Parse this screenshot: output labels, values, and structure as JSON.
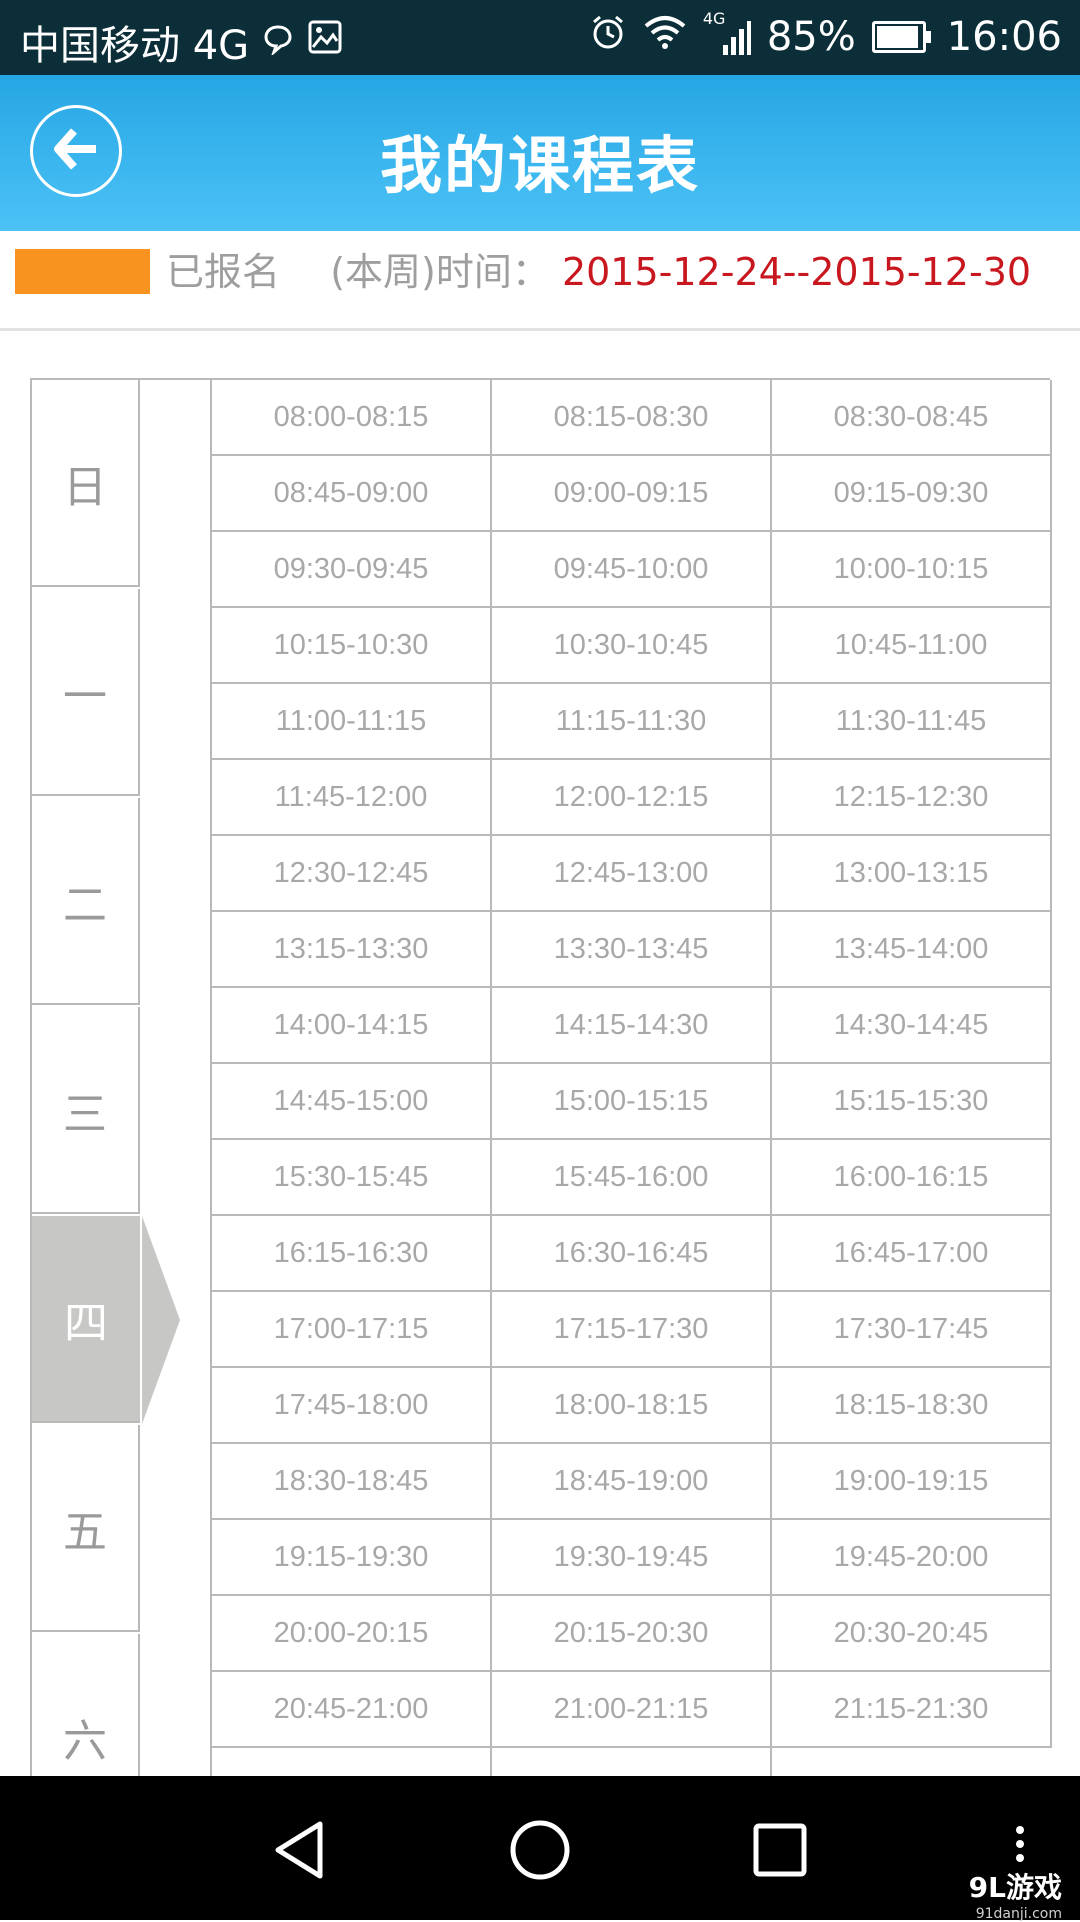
{
  "status_bar": {
    "carrier": "中国移动 4G",
    "signal_label": "4G",
    "battery": "85%",
    "battery_level": 0.85,
    "time": "16:06"
  },
  "header": {
    "title": "我的课程表"
  },
  "legend": {
    "swatch_color": "#f7931e",
    "registered_label": "已报名",
    "week_label": "(本周)时间：",
    "date_range": "2015-12-24--2015-12-30"
  },
  "days": [
    "日",
    "一",
    "二",
    "三",
    "四",
    "五",
    "六"
  ],
  "selected_day": "四",
  "time_slots": [
    "08:00-08:15",
    "08:15-08:30",
    "08:30-08:45",
    "08:45-09:00",
    "09:00-09:15",
    "09:15-09:30",
    "09:30-09:45",
    "09:45-10:00",
    "10:00-10:15",
    "10:15-10:30",
    "10:30-10:45",
    "10:45-11:00",
    "11:00-11:15",
    "11:15-11:30",
    "11:30-11:45",
    "11:45-12:00",
    "12:00-12:15",
    "12:15-12:30",
    "12:30-12:45",
    "12:45-13:00",
    "13:00-13:15",
    "13:15-13:30",
    "13:30-13:45",
    "13:45-14:00",
    "14:00-14:15",
    "14:15-14:30",
    "14:30-14:45",
    "14:45-15:00",
    "15:00-15:15",
    "15:15-15:30",
    "15:30-15:45",
    "15:45-16:00",
    "16:00-16:15",
    "16:15-16:30",
    "16:30-16:45",
    "16:45-17:00",
    "17:00-17:15",
    "17:15-17:30",
    "17:30-17:45",
    "17:45-18:00",
    "18:00-18:15",
    "18:15-18:30",
    "18:30-18:45",
    "18:45-19:00",
    "19:00-19:15",
    "19:15-19:30",
    "19:30-19:45",
    "19:45-20:00",
    "20:00-20:15",
    "20:15-20:30",
    "20:30-20:45",
    "20:45-21:00",
    "21:00-21:15",
    "21:15-21:30"
  ],
  "watermark": {
    "main": "9L游戏",
    "sub": "91danji.com"
  },
  "icons": {
    "back": "arrow-left-icon",
    "nav_back": "triangle-back-icon",
    "nav_home": "circle-home-icon",
    "nav_recents": "square-recents-icon",
    "nav_menu": "vertical-dots-icon"
  }
}
